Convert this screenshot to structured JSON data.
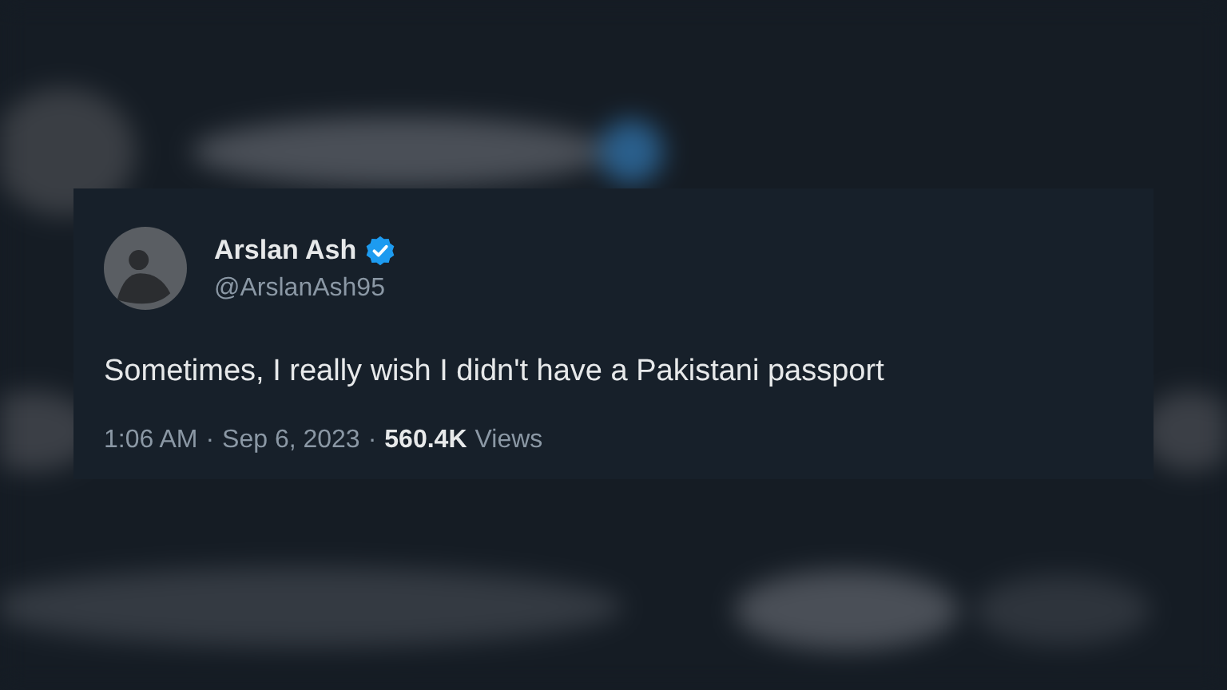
{
  "tweet": {
    "author": {
      "name": "Arslan Ash",
      "verified": true,
      "handle": "@ArslanAsh95"
    },
    "text": "Sometimes, I really wish I didn't have a Pakistani passport",
    "meta": [
      {
        "kind": "plain",
        "text": "1:06 AM"
      },
      {
        "kind": "separator",
        "text": "·"
      },
      {
        "kind": "plain",
        "text": "Sep 6, 2023"
      },
      {
        "kind": "separator",
        "text": "·"
      },
      {
        "kind": "strong",
        "text": "560.4K"
      },
      {
        "kind": "plain",
        "text": "Views"
      }
    ]
  }
}
